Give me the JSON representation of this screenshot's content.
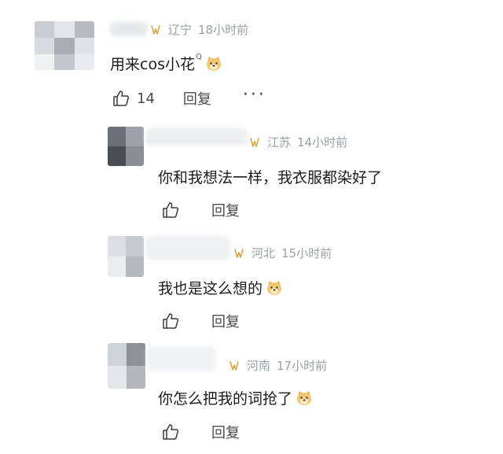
{
  "comments": [
    {
      "location": "辽宁",
      "time": "18小时前",
      "text": "用来cos小花",
      "superscript": "Q",
      "likes": "14",
      "reply_label": "回复",
      "more_label": "···",
      "emoji_icon": "doge-emoji-icon"
    },
    {
      "location": "江苏",
      "time": "14小时前",
      "text": "你和我想法一样，我衣服都染好了",
      "reply_label": "回复"
    },
    {
      "location": "河北",
      "time": "15小时前",
      "text": "我也是这么想的",
      "reply_label": "回复",
      "emoji_icon": "doge-emoji-icon"
    },
    {
      "location": "河南",
      "time": "17小时前",
      "text": "你怎么把我的词抢了",
      "reply_label": "回复",
      "emoji_icon": "doge-emoji-icon"
    }
  ],
  "colors": {
    "meta": "#9aa0a8",
    "badge": "#d9a53c",
    "text": "#1c1c1c"
  }
}
